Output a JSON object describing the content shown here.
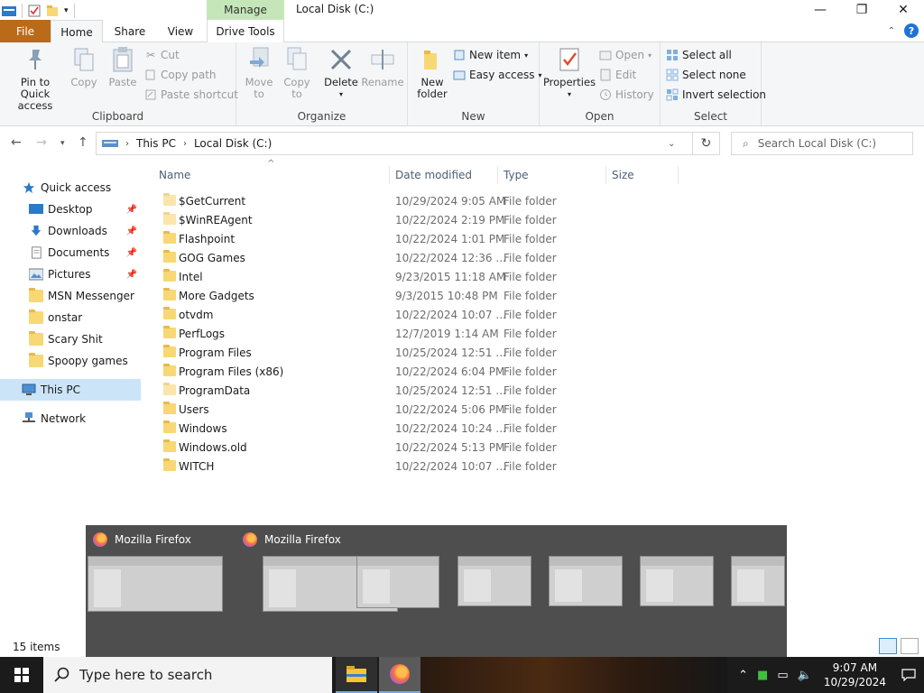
{
  "window": {
    "title": "Local Disk (C:)",
    "contextual_tab_group": "Manage"
  },
  "ribbon_tabs": {
    "file": "File",
    "home": "Home",
    "share": "Share",
    "view": "View",
    "drive_tools": "Drive Tools"
  },
  "ribbon": {
    "clipboard": {
      "label": "Clipboard",
      "pin_line1": "Pin to Quick",
      "pin_line2": "access",
      "copy": "Copy",
      "paste": "Paste",
      "cut": "Cut",
      "copy_path": "Copy path",
      "paste_shortcut": "Paste shortcut"
    },
    "organize": {
      "label": "Organize",
      "move_to_line1": "Move",
      "move_to_line2": "to",
      "copy_to_line1": "Copy",
      "copy_to_line2": "to",
      "delete": "Delete",
      "rename": "Rename"
    },
    "new": {
      "label": "New",
      "new_folder_line1": "New",
      "new_folder_line2": "folder",
      "new_item": "New item",
      "easy_access": "Easy access"
    },
    "open": {
      "label": "Open",
      "properties": "Properties",
      "open": "Open",
      "edit": "Edit",
      "history": "History"
    },
    "select": {
      "label": "Select",
      "select_all": "Select all",
      "select_none": "Select none",
      "invert_selection": "Invert selection"
    }
  },
  "address": {
    "crumb1": "This PC",
    "crumb2": "Local Disk (C:)",
    "search_placeholder": "Search Local Disk (C:)"
  },
  "nav_pane": {
    "quick_access": "Quick access",
    "desktop": "Desktop",
    "downloads": "Downloads",
    "documents": "Documents",
    "pictures": "Pictures",
    "msn": "MSN Messenger",
    "onstar": "onstar",
    "scary": "Scary Shit",
    "spoopy": "Spoopy games",
    "this_pc": "This PC",
    "network": "Network"
  },
  "columns": {
    "name": "Name",
    "date_modified": "Date modified",
    "type": "Type",
    "size": "Size"
  },
  "files": [
    {
      "name": "$GetCurrent",
      "date": "10/29/2024 9:05 AM",
      "type": "File folder"
    },
    {
      "name": "$WinREAgent",
      "date": "10/22/2024 2:19 PM",
      "type": "File folder"
    },
    {
      "name": "Flashpoint",
      "date": "10/22/2024 1:01 PM",
      "type": "File folder"
    },
    {
      "name": "GOG Games",
      "date": "10/22/2024 12:36 ...",
      "type": "File folder"
    },
    {
      "name": "Intel",
      "date": "9/23/2015 11:18 AM",
      "type": "File folder"
    },
    {
      "name": "More Gadgets",
      "date": "9/3/2015 10:48 PM",
      "type": "File folder"
    },
    {
      "name": "otvdm",
      "date": "10/22/2024 10:07 ...",
      "type": "File folder"
    },
    {
      "name": "PerfLogs",
      "date": "12/7/2019 1:14 AM",
      "type": "File folder"
    },
    {
      "name": "Program Files",
      "date": "10/25/2024 12:51 ...",
      "type": "File folder"
    },
    {
      "name": "Program Files (x86)",
      "date": "10/22/2024 6:04 PM",
      "type": "File folder"
    },
    {
      "name": "ProgramData",
      "date": "10/25/2024 12:51 ...",
      "type": "File folder"
    },
    {
      "name": "Users",
      "date": "10/22/2024 5:06 PM",
      "type": "File folder"
    },
    {
      "name": "Windows",
      "date": "10/22/2024 10:24 ...",
      "type": "File folder"
    },
    {
      "name": "Windows.old",
      "date": "10/22/2024 5:13 PM",
      "type": "File folder"
    },
    {
      "name": "WITCH",
      "date": "10/22/2024 10:07 ...",
      "type": "File folder"
    }
  ],
  "status": {
    "items": "15 items"
  },
  "thumbnails": {
    "title1": "Mozilla Firefox",
    "title2": "Mozilla Firefox"
  },
  "taskbar": {
    "search_placeholder": "Type here to search",
    "time": "9:07 AM",
    "date": "10/29/2024"
  },
  "colors": {
    "file_tab": "#b96b1a",
    "manage_tab": "#c5e6b8",
    "selection": "#cce4f7",
    "folder": "#f8d775"
  }
}
